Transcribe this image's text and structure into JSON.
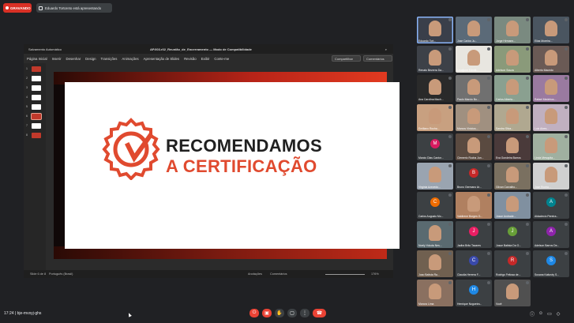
{
  "recording": {
    "label": "GRAVANDO"
  },
  "presenter": {
    "label": "Eduardo Tortoreto está apresentando"
  },
  "presentation": {
    "autosave": "Salvamento Automático",
    "doc_title": "AP.003.r02_Reunião_de_Encerramento",
    "mode": "Modo de Compatibilidade",
    "menu": [
      "Página Inicial",
      "Inserir",
      "Desenhar",
      "Design",
      "Transições",
      "Animações",
      "Apresentação de Slides",
      "Revisão",
      "Exibir",
      "Conte-me"
    ],
    "share_label": "Compartilhar",
    "comments_label": "Comentários",
    "thumbs": [
      "1",
      "2",
      "3",
      "4",
      "5",
      "6",
      "7",
      "8"
    ],
    "slide": {
      "line1": "RECOMENDAMOS",
      "line2": "A CERTIFICAÇÃO",
      "accent": "#e04a2f"
    },
    "status": {
      "slide_count": "Slide 6 de 8",
      "language": "Português (Brasil)",
      "notes": "Anotações",
      "comments": "Comentários",
      "zoom": "176%"
    }
  },
  "participants": [
    {
      "name": "Eduardo Tort...",
      "type": "video",
      "bg": "#3a3f4a"
    },
    {
      "name": "Jose Carlos Ju...",
      "type": "video",
      "bg": "#5b6a78"
    },
    {
      "name": "Jorge Hirmann...",
      "type": "video",
      "bg": "#7a8a80"
    },
    {
      "name": "Elias Moreira...",
      "type": "video",
      "bg": "#4a5560"
    },
    {
      "name": "Renato Bezerra Da...",
      "type": "video",
      "bg": "#3d4148"
    },
    {
      "name": "Leudjone Edmilt...",
      "type": "video",
      "bg": "#e8e6e0"
    },
    {
      "name": "Adelson Souza",
      "type": "video",
      "bg": "#8a9a7a"
    },
    {
      "name": "Alberto Macedo",
      "type": "video",
      "bg": "#6a5a55"
    },
    {
      "name": "Ana Carolina Mach...",
      "type": "video",
      "bg": "#2a2a2a"
    },
    {
      "name": "Paulo Marcio Bo...",
      "type": "video",
      "bg": "#707070"
    },
    {
      "name": "Carlos Alberto...",
      "type": "video",
      "bg": "#8aa090"
    },
    {
      "name": "Rafael Medeiros...",
      "type": "video",
      "bg": "#9a7aa0"
    },
    {
      "name": "Emiliano Rocha...",
      "type": "video",
      "bg": "#c8a080"
    },
    {
      "name": "Marcos Vinicius...",
      "type": "video",
      "bg": "#a09080"
    },
    {
      "name": "Sandra Silva...",
      "type": "video",
      "bg": "#b0a890"
    },
    {
      "name": "Luiz Alves...",
      "type": "video",
      "bg": "#c0b0c0"
    },
    {
      "name": "Marcio Dias Cantor...",
      "type": "avatar",
      "letter": "M",
      "color": "#d81b60"
    },
    {
      "name": "Clemerio Rocha Jun...",
      "type": "video",
      "bg": "#5a4a40"
    },
    {
      "name": "Eva Gondeira Barros",
      "type": "video",
      "bg": "#4a3a3a"
    },
    {
      "name": "Linda Mesquita...",
      "type": "video",
      "bg": "#a0b0a0"
    },
    {
      "name": "Virginia Azevedo...",
      "type": "video",
      "bg": "#9aa4b0"
    },
    {
      "name": "Bruno Germano Ar...",
      "type": "avatar",
      "letter": "B",
      "color": "#c62828"
    },
    {
      "name": "Gilvan Carvalho...",
      "type": "video",
      "bg": "#7a7060"
    },
    {
      "name": "Jose Rocha...",
      "type": "video",
      "bg": "#d0d0d0"
    },
    {
      "name": "Carlos Augusto Mo...",
      "type": "avatar",
      "letter": "C",
      "color": "#ef6c00"
    },
    {
      "name": "Valdirene Borges G...",
      "type": "video",
      "bg": "#b08060"
    },
    {
      "name": "Josue Andrade...",
      "type": "video",
      "bg": "#8090a0"
    },
    {
      "name": "Aldaclecio Pereira...",
      "type": "avatar",
      "letter": "A",
      "color": "#00838f"
    },
    {
      "name": "Noely Yokota Nes...",
      "type": "video",
      "bg": "#5a6a70"
    },
    {
      "name": "Jadira Brito Tavares",
      "type": "avatar",
      "letter": "J",
      "color": "#e91e63"
    },
    {
      "name": "Josue Batista Da O...",
      "type": "avatar",
      "letter": "J",
      "color": "#689f38"
    },
    {
      "name": "Adelson Barros De...",
      "type": "avatar",
      "letter": "A",
      "color": "#8e24aa"
    },
    {
      "name": "Joao Batista Ra...",
      "type": "video",
      "bg": "#706050"
    },
    {
      "name": "Claudia Herrera F...",
      "type": "avatar",
      "letter": "C",
      "color": "#3949ab"
    },
    {
      "name": "Rodrigo Feitosa de...",
      "type": "avatar",
      "letter": "R",
      "color": "#c62828"
    },
    {
      "name": "Susana Kafuroty S...",
      "type": "avatar",
      "letter": "S",
      "color": "#1e88e5"
    },
    {
      "name": "Marcos Lima",
      "type": "video",
      "bg": "#8a7060"
    },
    {
      "name": "Henrique Nogueira...",
      "type": "avatar",
      "letter": "H",
      "color": "#1e88e5"
    },
    {
      "name": "Você",
      "type": "video",
      "bg": "#505050"
    }
  ],
  "bottom": {
    "time_meet": "17:24  |  bje-mvsyj-ghs"
  }
}
